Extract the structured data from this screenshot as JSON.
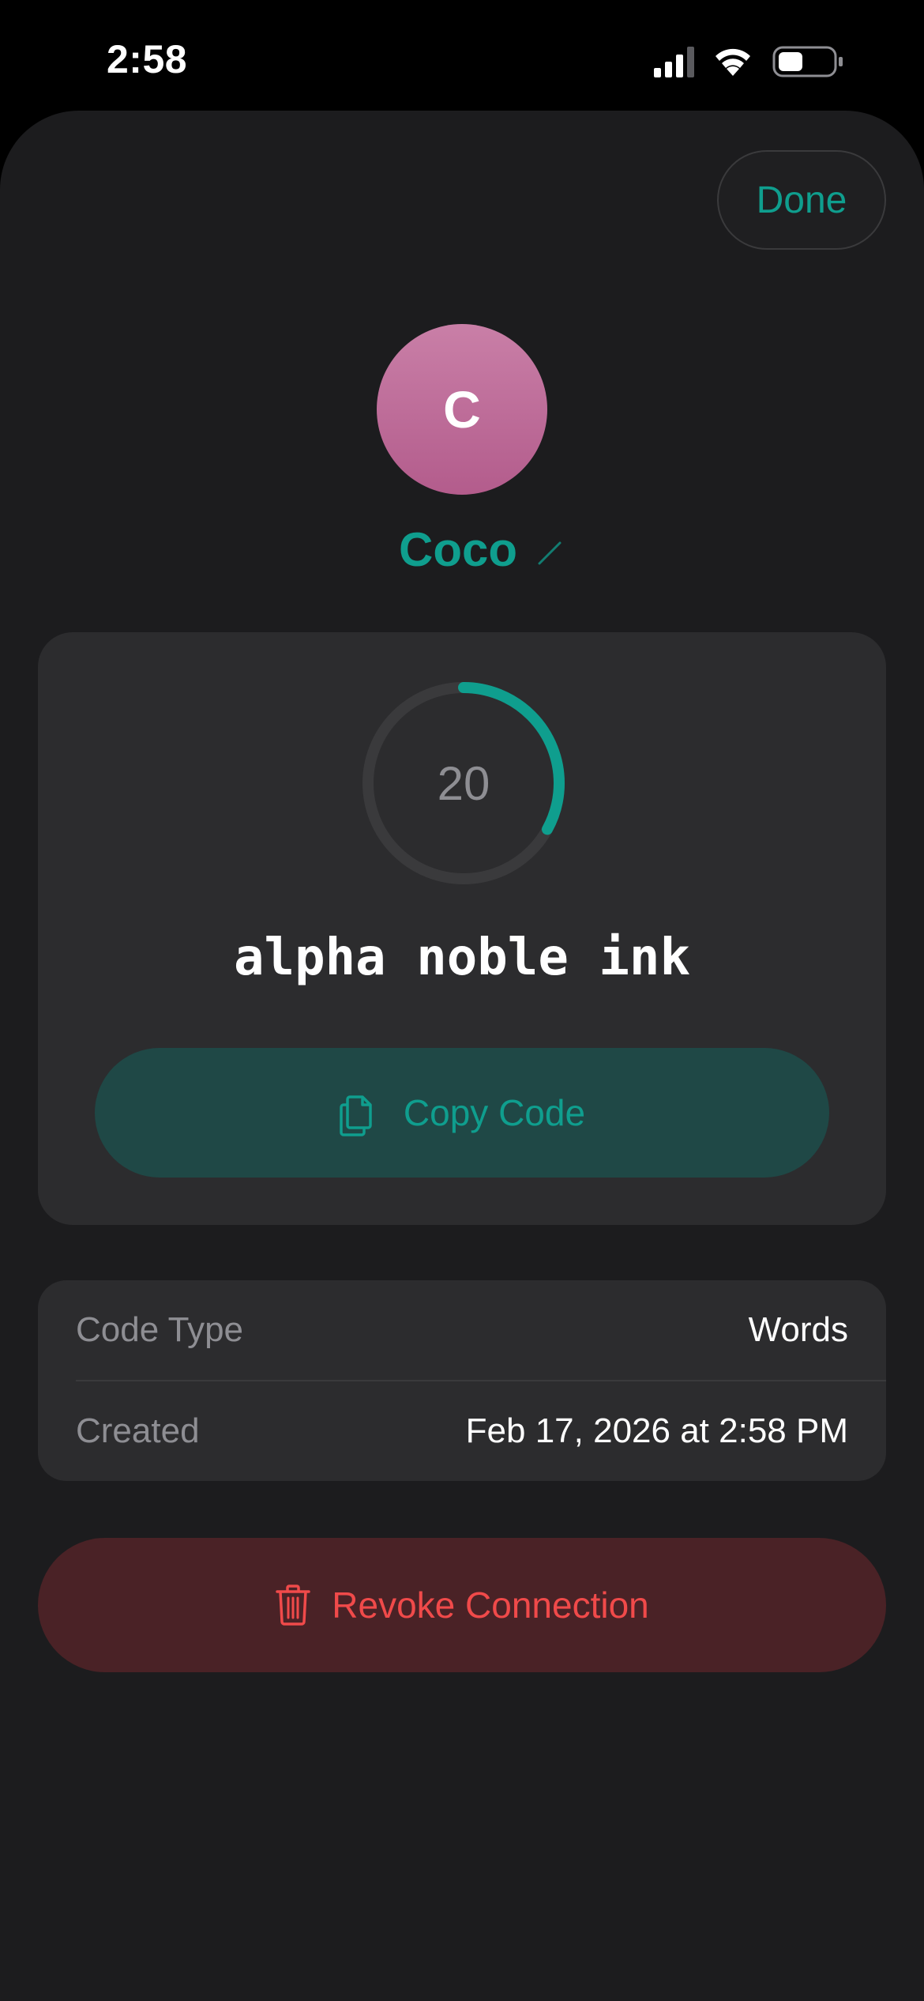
{
  "status_bar": {
    "time": "2:58",
    "icons": [
      "cellular-signal-icon",
      "wifi-icon",
      "battery-icon"
    ]
  },
  "header": {
    "done_label": "Done"
  },
  "contact": {
    "avatar_initial": "C",
    "name": "Coco",
    "edit_icon": "pencil-icon"
  },
  "code": {
    "timer_value": "20",
    "timer_progress": 0.33,
    "words": "alpha noble ink",
    "copy_label": "Copy Code",
    "copy_icon": "copy-icon"
  },
  "details": {
    "rows": [
      {
        "label": "Code Type",
        "value": "Words"
      },
      {
        "label": "Created",
        "value": "Feb 17, 2026 at 2:58 PM"
      }
    ]
  },
  "actions": {
    "revoke_label": "Revoke Connection",
    "revoke_icon": "trash-icon"
  },
  "colors": {
    "accent": "#0f9e8e",
    "danger": "#f04a4a",
    "avatar": "#b35c8c",
    "background": "#1c1c1e",
    "card": "#2c2c2e"
  }
}
